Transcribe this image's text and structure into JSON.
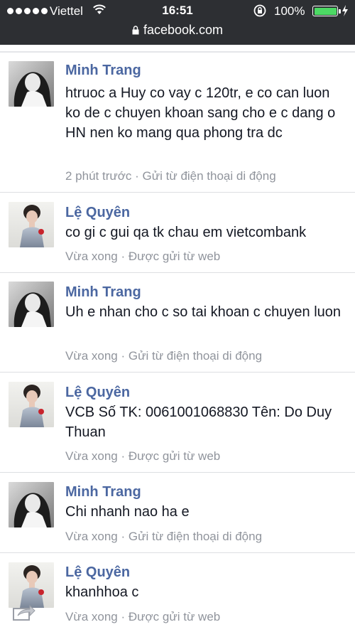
{
  "status_bar": {
    "carrier": "Viettel",
    "time": "16:51",
    "battery": "100%"
  },
  "browser": {
    "url": "facebook.com"
  },
  "messages": [
    {
      "sender": "Minh Trang",
      "text": "htruoc a Huy co vay c 120tr, e co can luon ko de c chuyen khoan sang cho e c dang o HN nen ko mang qua phong tra dc",
      "meta": "2 phút trước · Gửi từ điện thoại di động",
      "avatar": "minh-trang-avatar"
    },
    {
      "sender": "Lệ Quyên",
      "text": "co gi c gui qa tk chau em vietcombank",
      "meta": "Vừa xong · Được gửi từ web",
      "avatar": "le-quyen-avatar"
    },
    {
      "sender": "Minh Trang",
      "text": "Uh e nhan cho c so tai khoan c chuyen luon",
      "meta": "Vừa xong · Gửi từ điện thoại di động",
      "avatar": "minh-trang-avatar"
    },
    {
      "sender": "Lệ Quyên",
      "text": "VCB Số TK: 0061001068830 Tên: Do Duy Thuan",
      "meta": "Vừa xong · Được gửi từ web",
      "avatar": "le-quyen-avatar"
    },
    {
      "sender": "Minh Trang",
      "text": "Chi nhanh nao ha e",
      "meta": "Vừa xong · Gửi từ điện thoại di động",
      "avatar": "minh-trang-avatar"
    },
    {
      "sender": "Lệ Quyên",
      "text": "khanhhoa c",
      "meta": "Vừa xong · Được gửi từ web",
      "avatar": "le-quyen-avatar"
    }
  ],
  "icons": {
    "share": "share-icon"
  }
}
